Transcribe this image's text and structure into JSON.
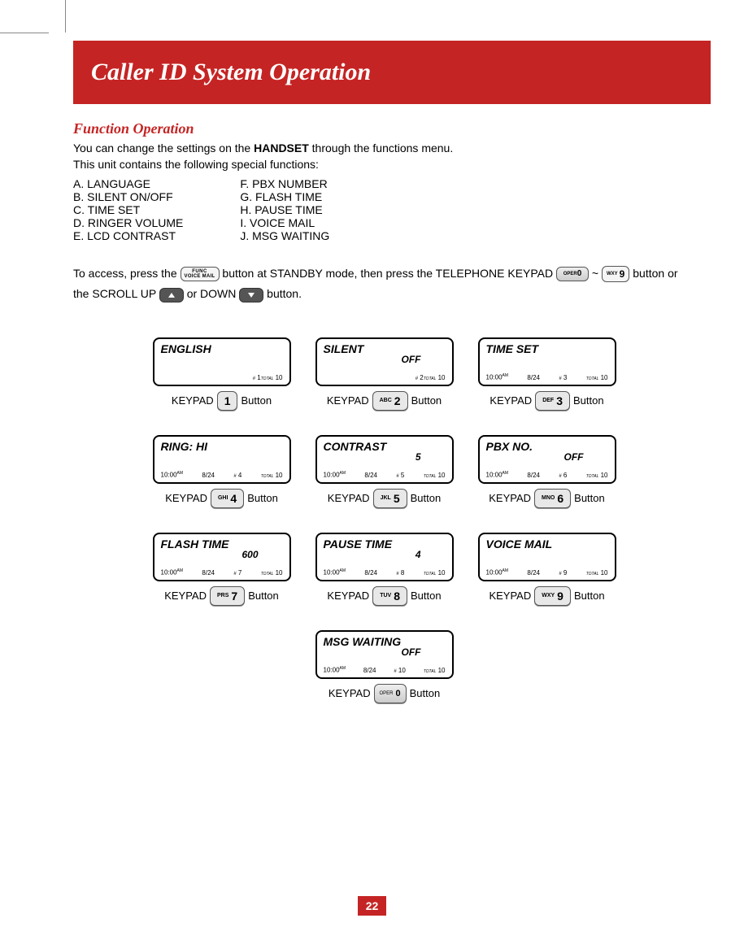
{
  "header": "Caller ID System Operation",
  "section_title": "Function Operation",
  "intro_line1_a": "You can change the settings on the ",
  "intro_line1_bold": "HANDSET",
  "intro_line1_b": " through the functions menu.",
  "intro_line2": "This unit contains the following special functions:",
  "functions_col1": "A. LANGUAGE\nB. SILENT ON/OFF\nC. TIME SET\nD. RINGER VOLUME\nE. LCD CONTRAST",
  "functions_col2": "F.  PBX NUMBER\nG. FLASH TIME\nH. PAUSE TIME\nI.   VOICE MAIL\nJ.  MSG WAITING",
  "access_text": {
    "t1": "To access, press the ",
    "func_l1": "FUNC",
    "func_l2": "VOICE MAIL",
    "t2": " button at STANDBY mode, then press the TELEPHONE KEYPAD ",
    "tilde": " ~ ",
    "wxy": "WXY",
    "nine": "9",
    "t3": " button or the SCROLL UP ",
    "t4": " or DOWN ",
    "t5": " button."
  },
  "keypad_word": "KEYPAD",
  "button_word": "Button",
  "screens": [
    {
      "title": "ENGLISH",
      "sub": "",
      "time": "",
      "date": "",
      "num": "1",
      "total": "10",
      "key_sub": "",
      "key_big": "1"
    },
    {
      "title": "SILENT",
      "sub": "OFF",
      "time": "",
      "date": "",
      "num": "2",
      "total": "10",
      "key_sub": "ABC",
      "key_big": "2"
    },
    {
      "title": "TIME SET",
      "sub": "",
      "time": "10:00",
      "am": "AM",
      "date": "8/24",
      "num": "3",
      "total": "10",
      "key_sub": "DEF",
      "key_big": "3"
    },
    {
      "title": "RING: HI",
      "sub": "",
      "time": "10:00",
      "am": "AM",
      "date": "8/24",
      "num": "4",
      "total": "10",
      "key_sub": "GHI",
      "key_big": "4"
    },
    {
      "title": "CONTRAST",
      "sub": "5",
      "time": "10:00",
      "am": "AM",
      "date": "8/24",
      "num": "5",
      "total": "10",
      "key_sub": "JKL",
      "key_big": "5"
    },
    {
      "title": "PBX NO.",
      "sub": "OFF",
      "time": "10:00",
      "am": "AM",
      "date": "8/24",
      "num": "6",
      "total": "10",
      "key_sub": "MNO",
      "key_big": "6"
    },
    {
      "title": "FLASH TIME",
      "sub": "600",
      "time": "10:00",
      "am": "AM",
      "date": "8/24",
      "num": "7",
      "total": "10",
      "key_sub": "PRS",
      "key_big": "7"
    },
    {
      "title": "PAUSE TIME",
      "sub": "4",
      "time": "10:00",
      "am": "AM",
      "date": "8/24",
      "num": "8",
      "total": "10",
      "key_sub": "TUV",
      "key_big": "8"
    },
    {
      "title": "VOICE MAIL",
      "sub": "",
      "time": "10:00",
      "am": "AM",
      "date": "8/24",
      "num": "9",
      "total": "10",
      "key_sub": "WXY",
      "key_big": "9"
    },
    {
      "title": "MSG WAITING",
      "sub": "OFF",
      "time": "10:00",
      "am": "AM",
      "date": "8/24",
      "num": "10",
      "total": "10",
      "key_sub": "OPER0",
      "key_big": ""
    }
  ],
  "total_label": "TOTAL",
  "page_number": "22"
}
